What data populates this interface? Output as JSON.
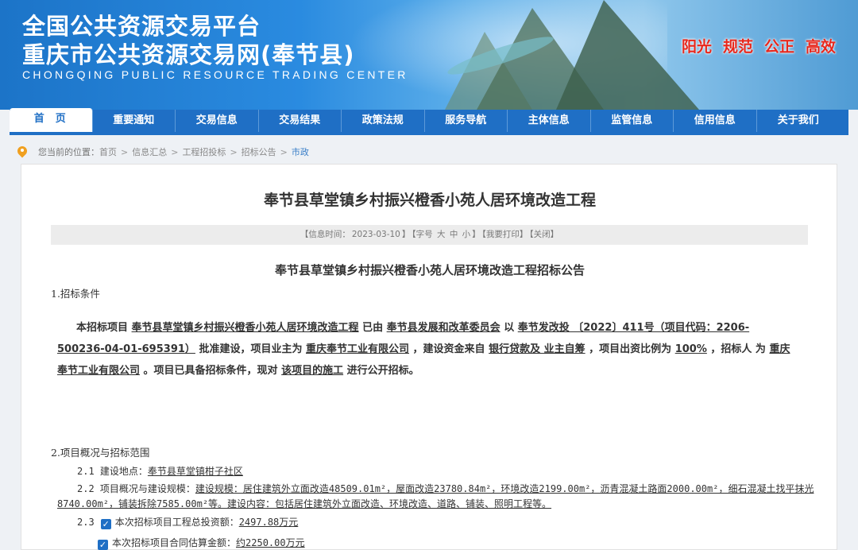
{
  "header": {
    "title_line1": "全国公共资源交易平台",
    "title_line2": "重庆市公共资源交易网(奉节县)",
    "title_en": "CHONGQING PUBLIC RESOURCE TRADING CENTER",
    "slogans": [
      "阳光",
      "规范",
      "公正",
      "高效"
    ],
    "slogan_color": "#e8271c"
  },
  "nav": {
    "items": [
      "首页",
      "重要通知",
      "交易信息",
      "交易结果",
      "政策法规",
      "服务导航",
      "主体信息",
      "监管信息",
      "信用信息",
      "关于我们"
    ],
    "active_index": 0,
    "bg_color": "#1f6fc5"
  },
  "breadcrumb": {
    "prefix": "您当前的位置：",
    "items": [
      "首页",
      "信息汇总",
      "工程招投标",
      "招标公告",
      "市政"
    ],
    "separator": ">"
  },
  "article": {
    "title": "奉节县草堂镇乡村振兴橙香小苑人居环境改造工程",
    "info": {
      "date_prefix": "【信息时间：",
      "date": "2023-03-10",
      "date_suffix": "】",
      "font_label": "【字号",
      "font_large": "大",
      "font_medium": "中",
      "font_small": "小",
      "font_end": "】",
      "print": "【我要打印】",
      "close": "【关闭】"
    },
    "subtitle": "奉节县草堂镇乡村振兴橙香小苑人居环境改造工程招标公告",
    "section1": "1.招标条件",
    "para": {
      "t1": "本招标项目",
      "project": "奉节县草堂镇乡村振兴橙香小苑人居环境改造工程",
      "t2": "已由",
      "approver": "奉节县发展和改革委员会",
      "t3": "以",
      "doc": "奉节发改投 〔2022〕411号（项目代码：2206-500236-04-01-695391）",
      "t4": "批准建设，项目业主为",
      "owner": "重庆奉节工业有限公司",
      "t5": "，建设资金来自",
      "fund": "银行贷款及 业主自筹",
      "t6": "，项目出资比例为",
      "ratio": "100%",
      "t7": "，招标人 为",
      "tenderer": "重庆奉节工业有限公司",
      "t8": "。项目已具备招标条件，现对",
      "scope": "该项目的施工",
      "t9": "进行公开招标。"
    },
    "section2": "2.项目概况与招标范围",
    "loc_label": "2.1 建设地点：",
    "loc_value": "奉节县草堂镇柑子社区",
    "scale_label": "2.2 项目概况与建设规模：",
    "scale_value_1": "建设规模：居住建筑外立面改造48509.01m²，屋面改造23780.84m²，环境改造2199.00m²，沥青混凝土路面2000.00m²，细石混凝土找平抹光",
    "scale_value_2": "8740.00m²，铺装拆除7585.00m²等。建设内容：包括居住建筑外立面改造、环境改造、道路、铺装、照明工程等。",
    "invest_num": "2.3",
    "invest_label": "本次招标项目工程总投资额：",
    "invest_value": "2497.88万元",
    "contract_label": "本次招标项目合同估算金额：",
    "contract_value": "约2250.00万元"
  }
}
